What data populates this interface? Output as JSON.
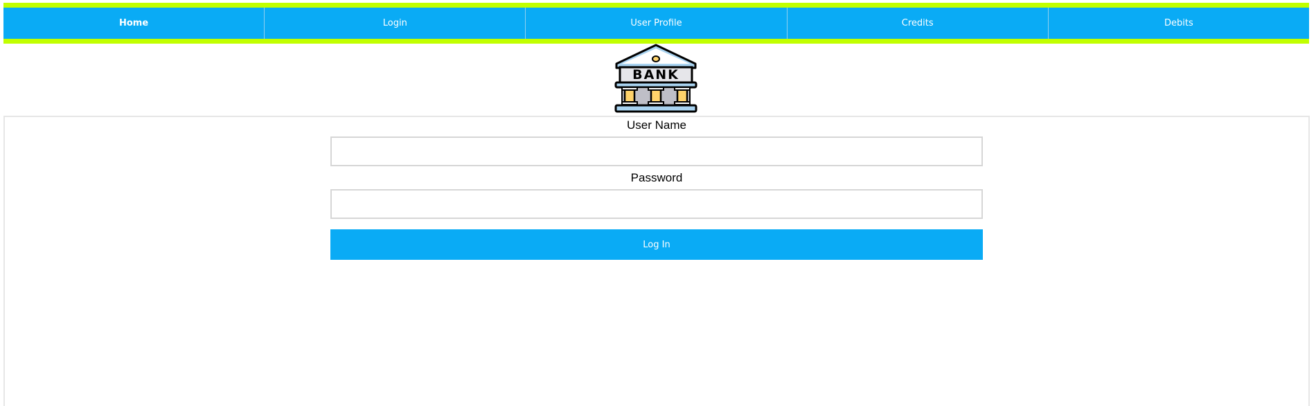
{
  "nav": {
    "items": [
      {
        "label": "Home",
        "active": true
      },
      {
        "label": "Login",
        "active": false
      },
      {
        "label": "User Profile",
        "active": false
      },
      {
        "label": "Credits",
        "active": false
      },
      {
        "label": "Debits",
        "active": false
      }
    ]
  },
  "logo": {
    "text": "BANK",
    "icon": "bank-icon"
  },
  "form": {
    "username_label": "User Name",
    "username_value": "",
    "password_label": "Password",
    "password_value": "",
    "submit_label": "Log In"
  },
  "colors": {
    "accent": "#0aabf5",
    "nav_border": "#c1ff00"
  }
}
